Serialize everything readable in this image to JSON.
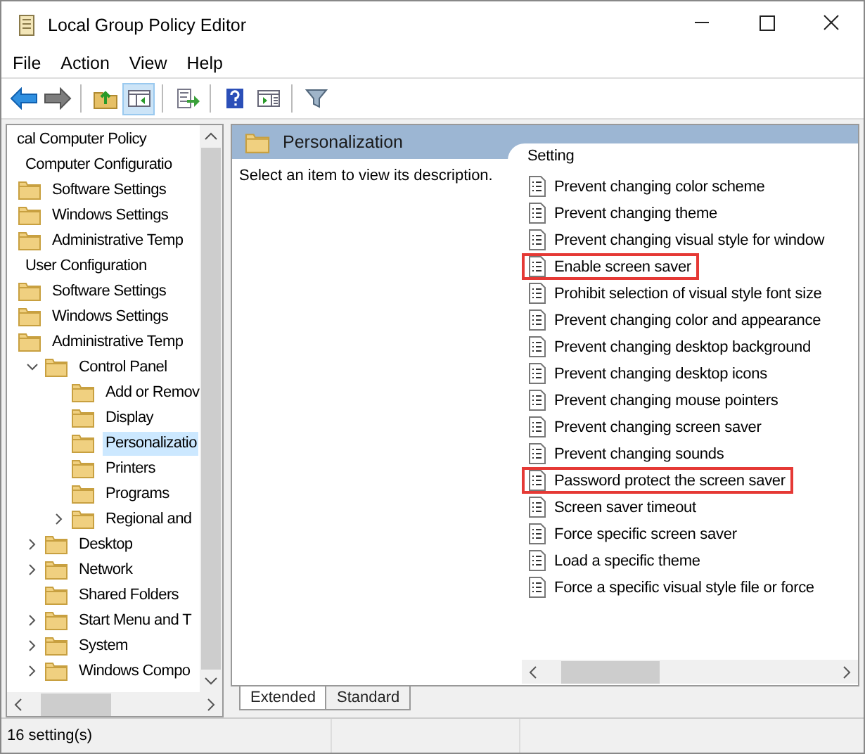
{
  "window": {
    "title": "Local Group Policy Editor"
  },
  "menu": [
    "File",
    "Action",
    "View",
    "Help"
  ],
  "toolbar": [
    {
      "kind": "back",
      "disabled": false,
      "pressed": false
    },
    {
      "kind": "forward",
      "disabled": true,
      "pressed": false
    },
    {
      "kind": "separator"
    },
    {
      "kind": "up",
      "pressed": false
    },
    {
      "kind": "tree",
      "pressed": true
    },
    {
      "kind": "separator"
    },
    {
      "kind": "export",
      "pressed": false
    },
    {
      "kind": "separator"
    },
    {
      "kind": "help",
      "pressed": false
    },
    {
      "kind": "actionpane",
      "pressed": false
    },
    {
      "kind": "separator"
    },
    {
      "kind": "filter",
      "pressed": false
    }
  ],
  "tree": [
    {
      "label": "cal Computer Policy",
      "selected": false,
      "children": [
        {
          "label": "Computer Configuratio",
          "selected": false,
          "children": [
            {
              "label": "Software Settings",
              "selected": false
            },
            {
              "label": "Windows Settings",
              "selected": false
            },
            {
              "label": "Administrative Temp",
              "selected": false
            }
          ]
        },
        {
          "label": "User Configuration",
          "selected": false,
          "children": [
            {
              "label": "Software Settings",
              "selected": false
            },
            {
              "label": "Windows Settings",
              "selected": false
            },
            {
              "label": "Administrative Temp",
              "selected": false,
              "children": [
                {
                  "label": "Control Panel",
                  "expanded": true,
                  "selected": false,
                  "children": [
                    {
                      "label": "Add or Remov",
                      "selected": false
                    },
                    {
                      "label": "Display",
                      "selected": false
                    },
                    {
                      "label": "Personalizatio",
                      "selected": true
                    },
                    {
                      "label": "Printers",
                      "selected": false
                    },
                    {
                      "label": "Programs",
                      "selected": false
                    },
                    {
                      "label": "Regional and",
                      "expanded": false,
                      "selected": false
                    }
                  ]
                },
                {
                  "label": "Desktop",
                  "expanded": false,
                  "selected": false
                },
                {
                  "label": "Network",
                  "expanded": false,
                  "selected": false
                },
                {
                  "label": "Shared Folders",
                  "selected": false
                },
                {
                  "label": "Start Menu and T",
                  "expanded": false,
                  "selected": false
                },
                {
                  "label": "System",
                  "expanded": false,
                  "selected": false
                },
                {
                  "label": "Windows Compo",
                  "expanded": false,
                  "selected": false
                }
              ]
            }
          ]
        }
      ]
    }
  ],
  "details": {
    "folder": "Personalization",
    "description": "Select an item to view its description.",
    "column": "Setting",
    "settings": [
      {
        "name": "Prevent changing color scheme",
        "highlighted": false
      },
      {
        "name": "Prevent changing theme",
        "highlighted": false
      },
      {
        "name": "Prevent changing visual style for window",
        "highlighted": false
      },
      {
        "name": "Enable screen saver",
        "highlighted": true
      },
      {
        "name": "Prohibit selection of visual style font size",
        "highlighted": false
      },
      {
        "name": "Prevent changing color and appearance",
        "highlighted": false
      },
      {
        "name": "Prevent changing desktop background",
        "highlighted": false
      },
      {
        "name": "Prevent changing desktop icons",
        "highlighted": false
      },
      {
        "name": "Prevent changing mouse pointers",
        "highlighted": false
      },
      {
        "name": "Prevent changing screen saver",
        "highlighted": false
      },
      {
        "name": "Prevent changing sounds",
        "highlighted": false
      },
      {
        "name": "Password protect the screen saver",
        "highlighted": true
      },
      {
        "name": "Screen saver timeout",
        "highlighted": false
      },
      {
        "name": "Force specific screen saver",
        "highlighted": false
      },
      {
        "name": "Load a specific theme",
        "highlighted": false
      },
      {
        "name": "Force a specific visual style file or force",
        "highlighted": false
      }
    ]
  },
  "view_tabs": [
    {
      "label": "Extended",
      "selected": true
    },
    {
      "label": "Standard",
      "selected": false
    }
  ],
  "status_bar": "16 setting(s)"
}
